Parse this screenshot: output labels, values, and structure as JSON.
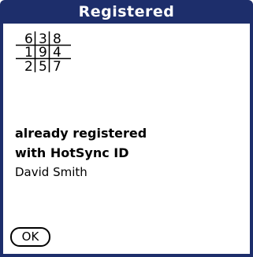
{
  "dialog": {
    "title": "Registered",
    "colors": {
      "title_bg": "#1d2e6b",
      "title_fg": "#ffffff",
      "frame": "#1d2e6b"
    }
  },
  "number_grid": [
    [
      "6",
      "3",
      "8"
    ],
    [
      "1",
      "9",
      "4"
    ],
    [
      "2",
      "5",
      "7"
    ]
  ],
  "message": {
    "line1": "already registered",
    "line2": "with HotSync ID",
    "hotsync_id": "David Smith"
  },
  "buttons": {
    "ok_label": "OK"
  }
}
